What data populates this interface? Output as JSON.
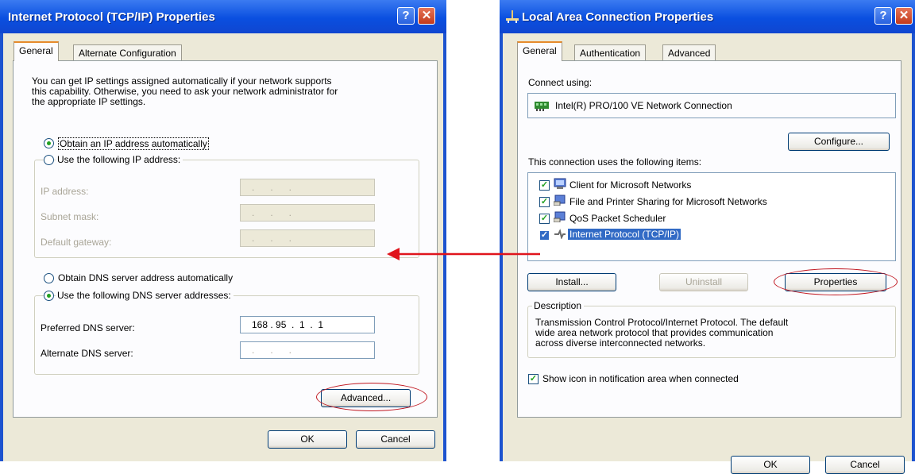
{
  "left_window": {
    "title": "Internet Protocol (TCP/IP) Properties",
    "help_glyph": "?",
    "close_glyph": "✕",
    "tabs": [
      "General",
      "Alternate Configuration"
    ],
    "intro": [
      "You can get IP settings assigned automatically if your network supports",
      "this capability. Otherwise, you need to ask your network administrator for",
      "the appropriate IP settings."
    ],
    "radio_auto_ip": "Obtain an IP address automatically",
    "radio_manual_ip": "Use the following IP address:",
    "ip_address_label": "IP address:",
    "subnet_mask_label": "Subnet mask:",
    "default_gateway_label": "Default gateway:",
    "empty_ip": ".      .      .",
    "radio_auto_dns": "Obtain DNS server address automatically",
    "radio_manual_dns": "Use the following DNS server addresses:",
    "preferred_dns_label": "Preferred DNS server:",
    "preferred_dns_value": "168 . 95  .  1  .  1",
    "alternate_dns_label": "Alternate DNS server:",
    "alternate_dns_value": ".      .      .",
    "advanced_button": "Advanced...",
    "ok_button": "OK",
    "cancel_button": "Cancel"
  },
  "right_window": {
    "title": "Local Area Connection Properties",
    "help_glyph": "?",
    "close_glyph": "✕",
    "tabs": [
      "General",
      "Authentication",
      "Advanced"
    ],
    "connect_using_label": "Connect using:",
    "adapter_name": "Intel(R) PRO/100 VE Network Connection",
    "configure_button": "Configure...",
    "items_label": "This connection uses the following items:",
    "items": [
      {
        "label": "Client for Microsoft Networks",
        "checked": true,
        "icon": "network-client-icon"
      },
      {
        "label": "File and Printer Sharing for Microsoft Networks",
        "checked": true,
        "icon": "file-sharing-icon"
      },
      {
        "label": "QoS Packet Scheduler",
        "checked": true,
        "icon": "qos-icon"
      },
      {
        "label": "Internet Protocol (TCP/IP)",
        "checked": true,
        "icon": "protocol-icon",
        "selected": true
      }
    ],
    "install_button": "Install...",
    "uninstall_button": "Uninstall",
    "properties_button": "Properties",
    "description_label": "Description",
    "description_text": [
      "Transmission Control Protocol/Internet Protocol. The default",
      "wide area network protocol that provides communication",
      "across diverse interconnected networks."
    ],
    "show_icon_label": "Show icon in notification area when connected",
    "show_icon_checked": true,
    "ok_button": "OK",
    "cancel_button": "Cancel"
  },
  "colors": {
    "annotation_red": "#c0161f",
    "arrow_red": "#e0141c",
    "xp_blue": "#0a4fe0",
    "selection_blue": "#316ac5"
  }
}
